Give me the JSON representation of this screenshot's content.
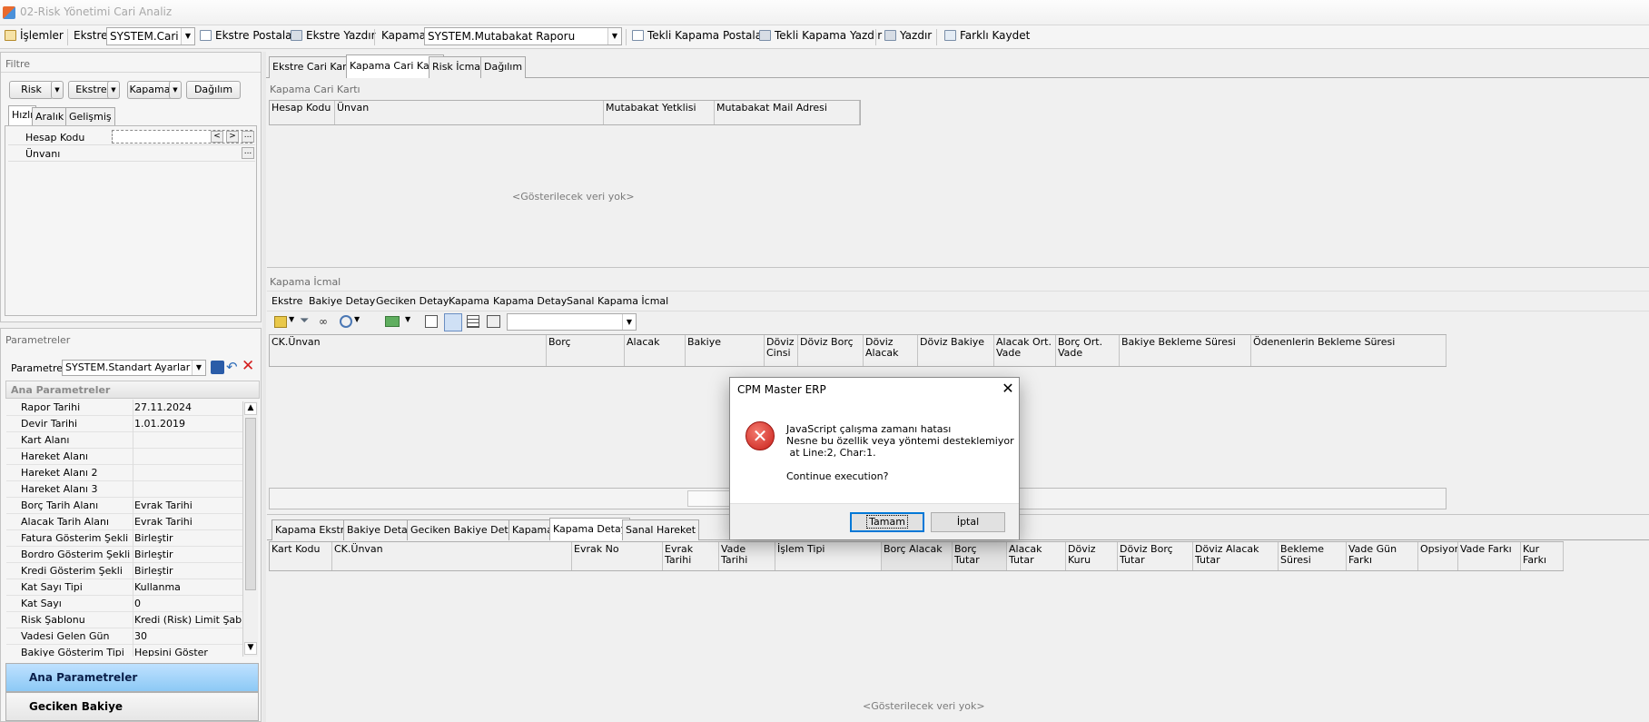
{
  "window": {
    "title": "02-Risk Yönetimi Cari Analiz"
  },
  "toolbar": {
    "islemler": "İşlemler",
    "ekstre_label": "Ekstre",
    "ekstre_value": "SYSTEM.Cari H",
    "ekstre_postala": "Ekstre Postala",
    "ekstre_yazdir": "Ekstre Yazdır",
    "kapama_label": "Kapama",
    "kapama_value": "SYSTEM.Mutabakat Raporu",
    "tekli_kapama_postala": "Tekli Kapama Postala",
    "tekli_kapama_yazdir": "Tekli Kapama Yazdır",
    "yazdir": "Yazdır",
    "farkli_kaydet": "Farklı Kaydet"
  },
  "filter": {
    "title": "Filtre",
    "buttons": [
      "Risk",
      "Ekstre",
      "Kapama",
      "Dağılım"
    ],
    "tabs": [
      "Hızlı",
      "Aralık",
      "Gelişmiş"
    ],
    "rows": [
      "Hesap Kodu",
      "Ünvanı"
    ],
    "nav_prev": "<",
    "nav_next": ">",
    "ellipsis": "..."
  },
  "params": {
    "title": "Parametreler",
    "param_label": "Parametre:",
    "param_value": "SYSTEM.Standart Ayarlar",
    "section": "Ana Parametreler",
    "rows": [
      {
        "k": "Rapor Tarihi",
        "v": "27.11.2024"
      },
      {
        "k": "Devir Tarihi",
        "v": "1.01.2019"
      },
      {
        "k": "Kart Alanı",
        "v": ""
      },
      {
        "k": "Hareket Alanı",
        "v": ""
      },
      {
        "k": "Hareket Alanı 2",
        "v": ""
      },
      {
        "k": "Hareket Alanı 3",
        "v": ""
      },
      {
        "k": "Borç Tarih Alanı",
        "v": "Evrak Tarihi"
      },
      {
        "k": "Alacak Tarih Alanı",
        "v": "Evrak Tarihi"
      },
      {
        "k": "Fatura Gösterim Şekli",
        "v": "Birleştir"
      },
      {
        "k": "Bordro Gösterim Şekli",
        "v": "Birleştir"
      },
      {
        "k": "Kredi Gösterim Şekli",
        "v": "Birleştir"
      },
      {
        "k": "Kat Sayı Tipi",
        "v": "Kullanma"
      },
      {
        "k": "Kat Sayı",
        "v": "0"
      },
      {
        "k": "Risk Şablonu",
        "v": "Kredi (Risk) Limit Şablonu"
      },
      {
        "k": "Vadesi Gelen Gün",
        "v": "30"
      },
      {
        "k": "Bakiye Gösterim Tipi",
        "v": "Hepsini Göster"
      }
    ],
    "accordion": [
      "Ana Parametreler",
      "Geciken Bakiye"
    ]
  },
  "main": {
    "tabs": [
      "Ekstre Cari Kartı",
      "Kapama Cari Kartı",
      "Risk İcmal",
      "Dağılım"
    ],
    "kapama_cari_title": "Kapama Cari Kartı",
    "kapama_cari_cols": [
      "Hesap Kodu",
      "Ünvan",
      "Mutabakat Yetklisi",
      "Mutabakat Mail Adresi"
    ],
    "empty": "<Gösterilecek veri yok>",
    "kapama_icmal_title": "Kapama İcmal",
    "icmal_menu": [
      "Ekstre",
      "Bakiye Detay",
      "Geciken Detay",
      "Kapama",
      "Kapama Detay",
      "Sanal Kapama İcmal"
    ],
    "icmal_cols": [
      "CK.Ünvan",
      "Borç",
      "Alacak",
      "Bakiye",
      "Döviz Cinsi",
      "Döviz Borç",
      "Döviz Alacak",
      "Döviz Bakiye",
      "Alacak Ort. Vade",
      "Borç Ort. Vade",
      "Bakiye Bekleme Süresi",
      "Ödenenlerin Bekleme Süresi"
    ],
    "bottom_tabs": [
      "Kapama Ekstre",
      "Bakiye Detay",
      "Geciken Bakiye Detay",
      "Kapama",
      "Kapama Detay",
      "Sanal Hareket"
    ],
    "bottom_cols": [
      "Kart Kodu",
      "CK.Ünvan",
      "Evrak No",
      "Evrak Tarihi",
      "Vade Tarihi",
      "İşlem Tipi",
      "Borç Alacak",
      "Borç Tutar",
      "Alacak Tutar",
      "Döviz Kuru",
      "Döviz Borç Tutar",
      "Döviz Alacak Tutar",
      "Bekleme Süresi",
      "Vade Gün Farkı",
      "Opsiyon",
      "Vade Farkı",
      "Kur Farkı"
    ]
  },
  "dialog": {
    "title": "CPM Master ERP",
    "line1": "JavaScript çalışma zamanı hatası",
    "line2": "Nesne bu özellik veya yöntemi desteklemiyor",
    "line3": " at Line:2, Char:1.",
    "line4": "Continue execution?",
    "ok": "Tamam",
    "cancel": "İptal",
    "close": "✕"
  }
}
